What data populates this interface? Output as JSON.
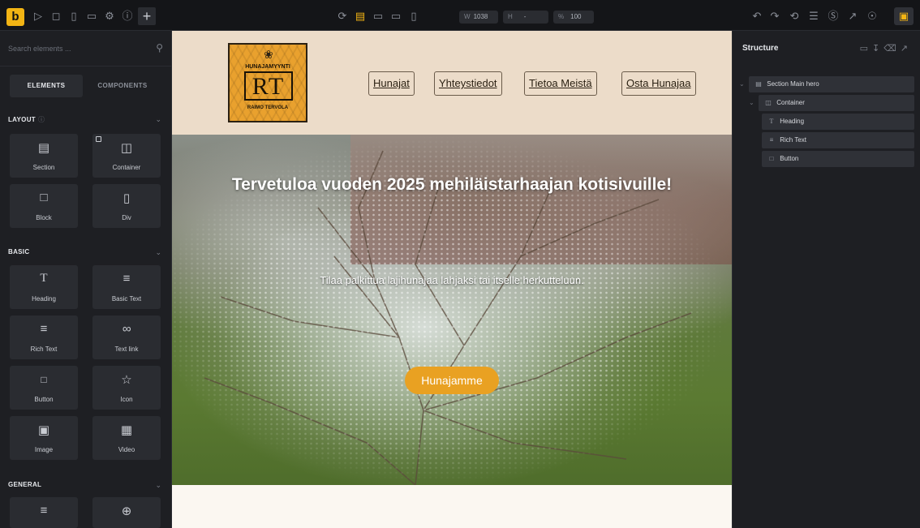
{
  "toolbar": {
    "brand_letter": "b",
    "width_label": "W",
    "width_value": "1038",
    "height_label": "H",
    "height_value": "-",
    "zoom_label": "%",
    "zoom_value": "100"
  },
  "left_panel": {
    "search_placeholder": "Search elements ...",
    "tabs": [
      "ELEMENTS",
      "COMPONENTS"
    ],
    "groups": {
      "layout": "LAYOUT",
      "basic": "BASIC",
      "general": "GENERAL"
    },
    "layout_items": [
      "Section",
      "Container",
      "Block",
      "Div"
    ],
    "basic_items": [
      "Heading",
      "Basic Text",
      "Rich Text",
      "Text link",
      "Button",
      "Icon",
      "Image",
      "Video"
    ]
  },
  "site": {
    "logo": {
      "top_text": "HUNAJAMYYNTI",
      "initials": "RT",
      "bottom_text": "RAIMO TERVOLA"
    },
    "nav": [
      "Hunajat",
      "Yhteystiedot",
      "Tietoa Meistä",
      "Osta Hunajaa"
    ],
    "hero": {
      "heading": "Tervetuloa vuoden 2025 mehiläistarhaajan kotisivuille!",
      "text": "Tilaa palkittua lajihunajaa lahjaksi tai itselle herkutteluun.",
      "button": "Hunajamme"
    }
  },
  "right_panel": {
    "title": "Structure",
    "tree": [
      "Section Main hero",
      "Container",
      "Heading",
      "Rich Text",
      "Button"
    ]
  },
  "colors": {
    "accent": "#f2b414",
    "header_bg": "#ecdcc9",
    "cta": "#e9a122",
    "panel_bg": "#1e1f23"
  }
}
